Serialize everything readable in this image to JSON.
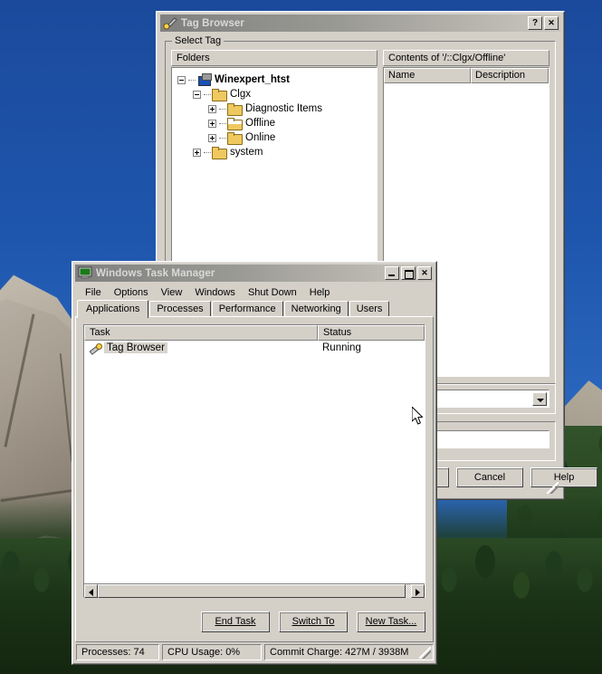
{
  "desktop": {
    "wallpaper_name": "mount-rushmore-wallpaper"
  },
  "tag_browser": {
    "title": "Tag Browser",
    "icon": "tag-browser-icon",
    "help_button": "?",
    "close_button": "✕",
    "group_label": "Select Tag",
    "folders_header": "Folders",
    "contents_header": "Contents of '/::Clgx/Offline'",
    "contents_columns": [
      "Name",
      "Description"
    ],
    "tree": [
      {
        "label": "Winexpert_htst",
        "icon": "computer-icon",
        "expander": "minus",
        "depth": 0,
        "bold": true
      },
      {
        "label": "Clgx",
        "icon": "folder-icon",
        "expander": "minus",
        "depth": 1,
        "bold": false
      },
      {
        "label": "Diagnostic Items",
        "icon": "folder-icon",
        "expander": "plus",
        "depth": 2,
        "bold": false
      },
      {
        "label": "Offline",
        "icon": "folder-open-icon",
        "expander": "plus",
        "depth": 2,
        "bold": false
      },
      {
        "label": "Online",
        "icon": "folder-icon",
        "expander": "plus",
        "depth": 2,
        "bold": false
      },
      {
        "label": "system",
        "icon": "folder-icon",
        "expander": "plus",
        "depth": 1,
        "bold": false
      }
    ],
    "combo_value": "",
    "text_value": "",
    "buttons": {
      "cancel": "Cancel",
      "help": "Help"
    }
  },
  "task_manager": {
    "title": "Windows Task Manager",
    "icon": "task-manager-icon",
    "window_buttons": {
      "minimize": "_",
      "maximize": "□",
      "close": "✕"
    },
    "menu": [
      "File",
      "Options",
      "View",
      "Windows",
      "Shut Down",
      "Help"
    ],
    "tabs": [
      {
        "label": "Applications",
        "active": true
      },
      {
        "label": "Processes",
        "active": false
      },
      {
        "label": "Performance",
        "active": false
      },
      {
        "label": "Networking",
        "active": false
      },
      {
        "label": "Users",
        "active": false
      }
    ],
    "task_columns": [
      "Task",
      "Status"
    ],
    "tasks": [
      {
        "name": "Tag Browser",
        "status": "Running",
        "icon": "tag-browser-icon",
        "selected": true
      }
    ],
    "buttons": {
      "end_task": "End Task",
      "switch_to": "Switch To",
      "new_task": "New Task..."
    },
    "status_bar": {
      "processes": "Processes: 74",
      "cpu_usage": "CPU Usage: 0%",
      "commit_charge": "Commit Charge: 427M / 3938M"
    }
  },
  "colors": {
    "window_face": "#d4d0c8",
    "title_inactive_start": "#808080",
    "title_inactive_end": "#c9c6bf",
    "folder_yellow": "#f0c860",
    "sky_blue": "#1e56ad"
  }
}
